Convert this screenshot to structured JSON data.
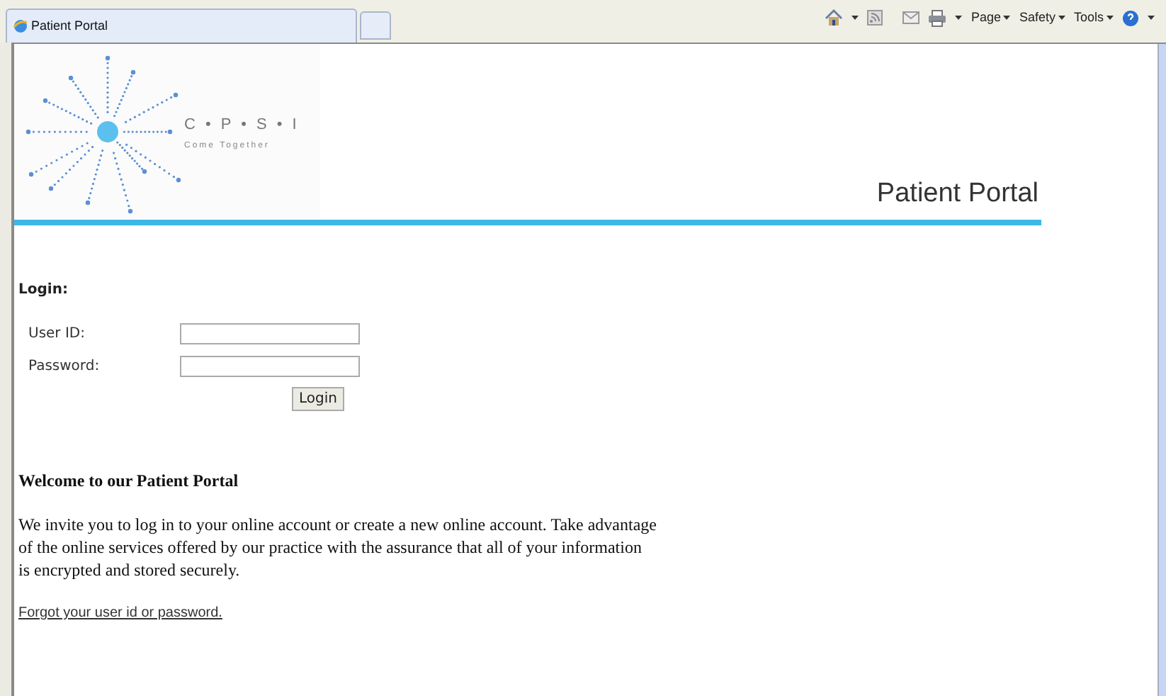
{
  "browser": {
    "tabs": [
      {
        "label": "Patient Portal",
        "selected": true
      }
    ],
    "command_menus": [
      "Page",
      "Safety",
      "Tools"
    ]
  },
  "logo": {
    "letters": "C • P • S • I",
    "tagline": "Come Together"
  },
  "header_title": "Patient Portal",
  "login": {
    "heading": "Login:",
    "fields": [
      {
        "label": "User ID:"
      },
      {
        "label": "Password:"
      }
    ],
    "button": "Login"
  },
  "welcome": {
    "heading": "Welcome to our Patient Portal",
    "lines": [
      "We invite you to log in to your online account or create a new online account. Take advantage",
      "of the online services offered by our practice with the assurance that all of your information",
      "is encrypted and stored securely."
    ],
    "link": "Forgot your user id or password."
  }
}
